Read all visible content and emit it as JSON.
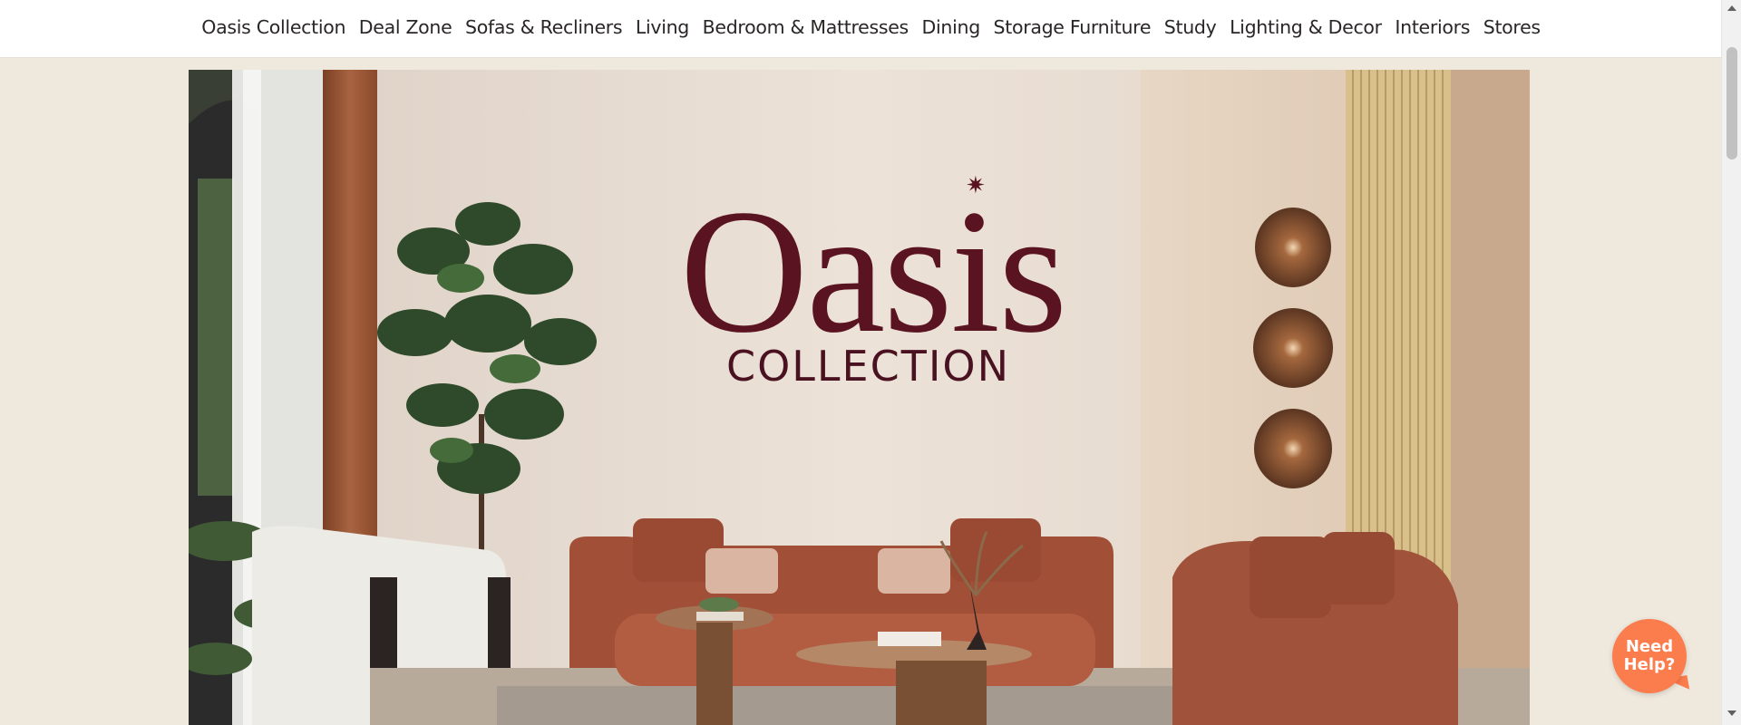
{
  "nav": {
    "items": [
      "Oasis Collection",
      "Deal Zone",
      "Sofas & Recliners",
      "Living",
      "Bedroom & Mattresses",
      "Dining",
      "Storage Furniture",
      "Study",
      "Lighting & Decor",
      "Interiors",
      "Stores"
    ]
  },
  "hero": {
    "brand": "Oasis",
    "subtitle": "COLLECTION",
    "colors": {
      "brand": "#5a1421",
      "wall": "#e8ddd3",
      "sofa": "#a4533c",
      "curtain": "#9b5a3b",
      "floor": "#c9bdb0"
    }
  },
  "help": {
    "line1": "Need",
    "line2": "Help?",
    "color": "#fb7c4c"
  },
  "page": {
    "background": "#efe8dd"
  }
}
